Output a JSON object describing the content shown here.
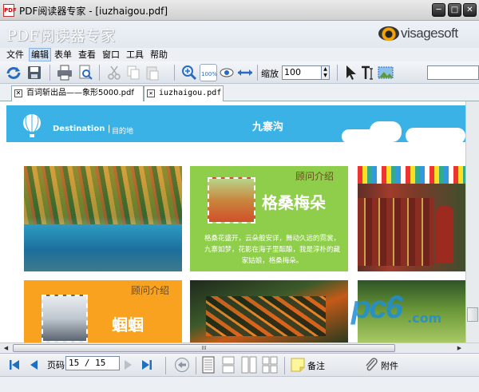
{
  "window": {
    "title": "PDF阅读器专家 - [iuzhaigou.pdf]",
    "app_icon_text": "PDF",
    "controls": {
      "minimize": "─",
      "maximize": "□",
      "close": "✕"
    }
  },
  "banner": {
    "app_name": "PDF阅读器专家",
    "logo_text": "visagesoft",
    "logo_color": "#f4a300"
  },
  "menu": {
    "items": [
      "文件",
      "编辑",
      "表单",
      "查看",
      "窗口",
      "工具",
      "帮助"
    ],
    "active": "编辑"
  },
  "toolbar": {
    "icons": [
      "refresh-icon",
      "save-icon",
      "print-icon",
      "print-preview-icon",
      "cut-icon",
      "copy-icon",
      "paste-icon",
      "zoom-in-icon",
      "actual-size-icon",
      "eye-icon",
      "fit-width-icon",
      "select-arrow-icon",
      "text-select-icon",
      "snapshot-icon"
    ],
    "actual_size_label": "100%",
    "zoom_label": "缩放",
    "zoom_value": "100"
  },
  "tabs": [
    {
      "label": "百词斩出品——象形5000.pdf",
      "close": "✕"
    },
    {
      "label": "iuzhaigou.pdf",
      "close": "✕"
    }
  ],
  "document": {
    "header_destination": "Destination",
    "header_destination_cn": "目的地",
    "location": "九寨沟",
    "card_green": {
      "title": "顾问介绍",
      "name": "格桑梅朵",
      "text": "格桑花盛开，云朵般安详，舞动久远的霓裳，九寨如梦，花影在海子里酝酿，我是淳朴的藏家姑娘，格桑梅朵。"
    },
    "card_orange": {
      "title": "顾问介绍",
      "name": "蝈蝈"
    },
    "watermark": "pc6",
    "watermark_com": ".com",
    "accent_color": "#3ab2e6",
    "green_color": "#8fce4a",
    "orange_color": "#f9a21f"
  },
  "scrollbar": {
    "grip": "III"
  },
  "bottom": {
    "page_label": "页码",
    "page_value": "15 / 15",
    "note_label": "备注",
    "attach_label": "附件"
  }
}
